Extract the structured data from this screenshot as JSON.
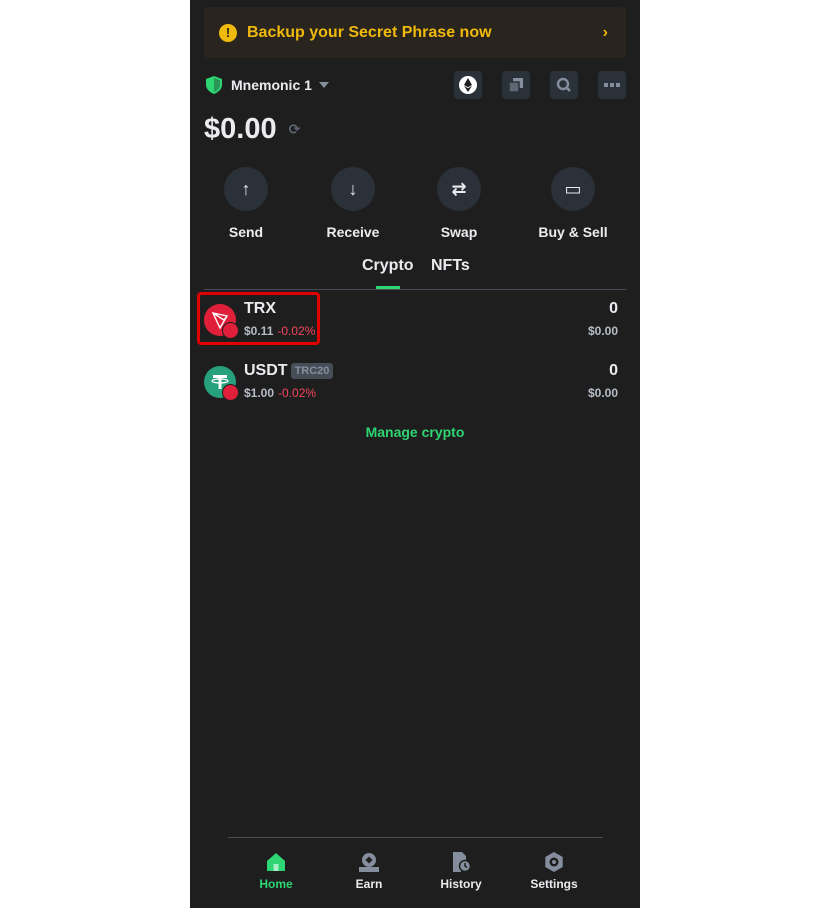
{
  "banner": {
    "text": "Backup your Secret Phrase now",
    "icon": "exclamation-icon",
    "chevron": "›"
  },
  "account": {
    "name": "Mnemonic 1"
  },
  "header_icons": [
    "ethereum-network-icon",
    "copy-icon",
    "search-icon",
    "more-icon"
  ],
  "balance": {
    "amount": "$0.00",
    "refresh_icon": "⟳"
  },
  "actions": [
    {
      "label": "Send",
      "glyph": "↑"
    },
    {
      "label": "Receive",
      "glyph": "↓"
    },
    {
      "label": "Swap",
      "glyph": "⇄"
    },
    {
      "label": "Buy & Sell",
      "glyph": "▭"
    }
  ],
  "tabs": [
    {
      "label": "Crypto",
      "active": true
    },
    {
      "label": "NFTs",
      "active": false
    }
  ],
  "assets": [
    {
      "symbol": "TRX",
      "badge": "",
      "price": "$0.11",
      "change": "-0.02%",
      "quantity": "0",
      "value": "$0.00",
      "color": "#e0203a"
    },
    {
      "symbol": "USDT",
      "badge": "TRC20",
      "price": "$1.00",
      "change": "-0.02%",
      "quantity": "0",
      "value": "$0.00",
      "color": "#26a17b"
    }
  ],
  "manage_label": "Manage crypto",
  "nav": [
    {
      "label": "Home",
      "active": true
    },
    {
      "label": "Earn",
      "active": false
    },
    {
      "label": "History",
      "active": false
    },
    {
      "label": "Settings",
      "active": false
    }
  ],
  "colors": {
    "accent": "#2ed573",
    "warning": "#f0b90b",
    "negative": "#f6465d",
    "background": "#1e1e1e"
  }
}
